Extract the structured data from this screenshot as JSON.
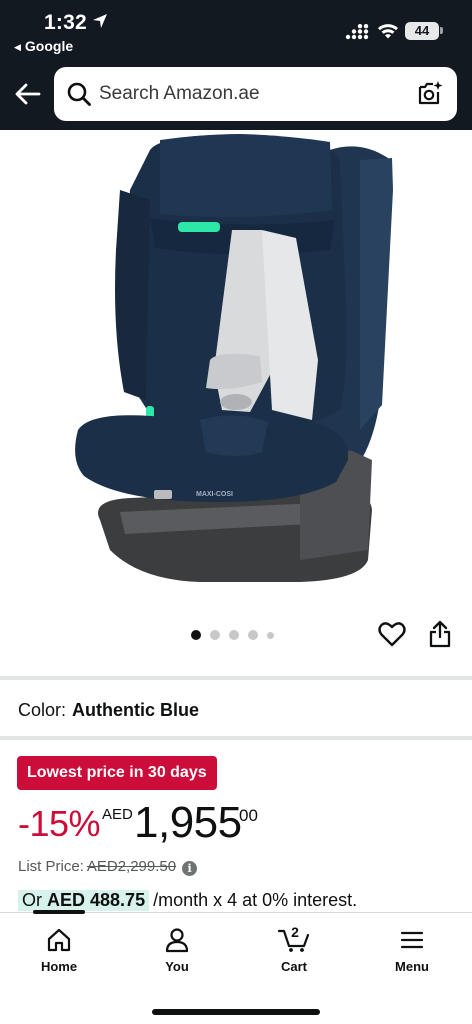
{
  "status_bar": {
    "time": "1:32",
    "back_app": "Google",
    "battery": "44"
  },
  "header": {
    "search_placeholder": "Search Amazon.ae"
  },
  "gallery": {
    "image_count": 5,
    "active_index": 0,
    "image_alt": "Child car seat product photo",
    "seat_brand_text": "MAXI-COSI"
  },
  "product": {
    "color_label": "Color:",
    "color_value": "Authentic Blue",
    "deal_badge": "Lowest price in 30 days",
    "discount": "-15%",
    "currency": "AED",
    "price_whole": "1,955",
    "price_fraction": "00",
    "list_price_label": "List Price:",
    "list_price_value": "AED2,299.50",
    "installment_prefix": "Or",
    "installment_amount": "AED 488.75",
    "installment_rest": "/month x 4 at 0% interest."
  },
  "bottom_nav": {
    "home": "Home",
    "you": "You",
    "cart": "Cart",
    "cart_count": "2",
    "menu": "Menu"
  },
  "colors": {
    "header_bg": "#131921",
    "deal_red": "#cc0c39",
    "installment_bg": "#d6f2ea",
    "seat_fabric": "#1b3048",
    "isofix_green": "#2ee8a8"
  }
}
